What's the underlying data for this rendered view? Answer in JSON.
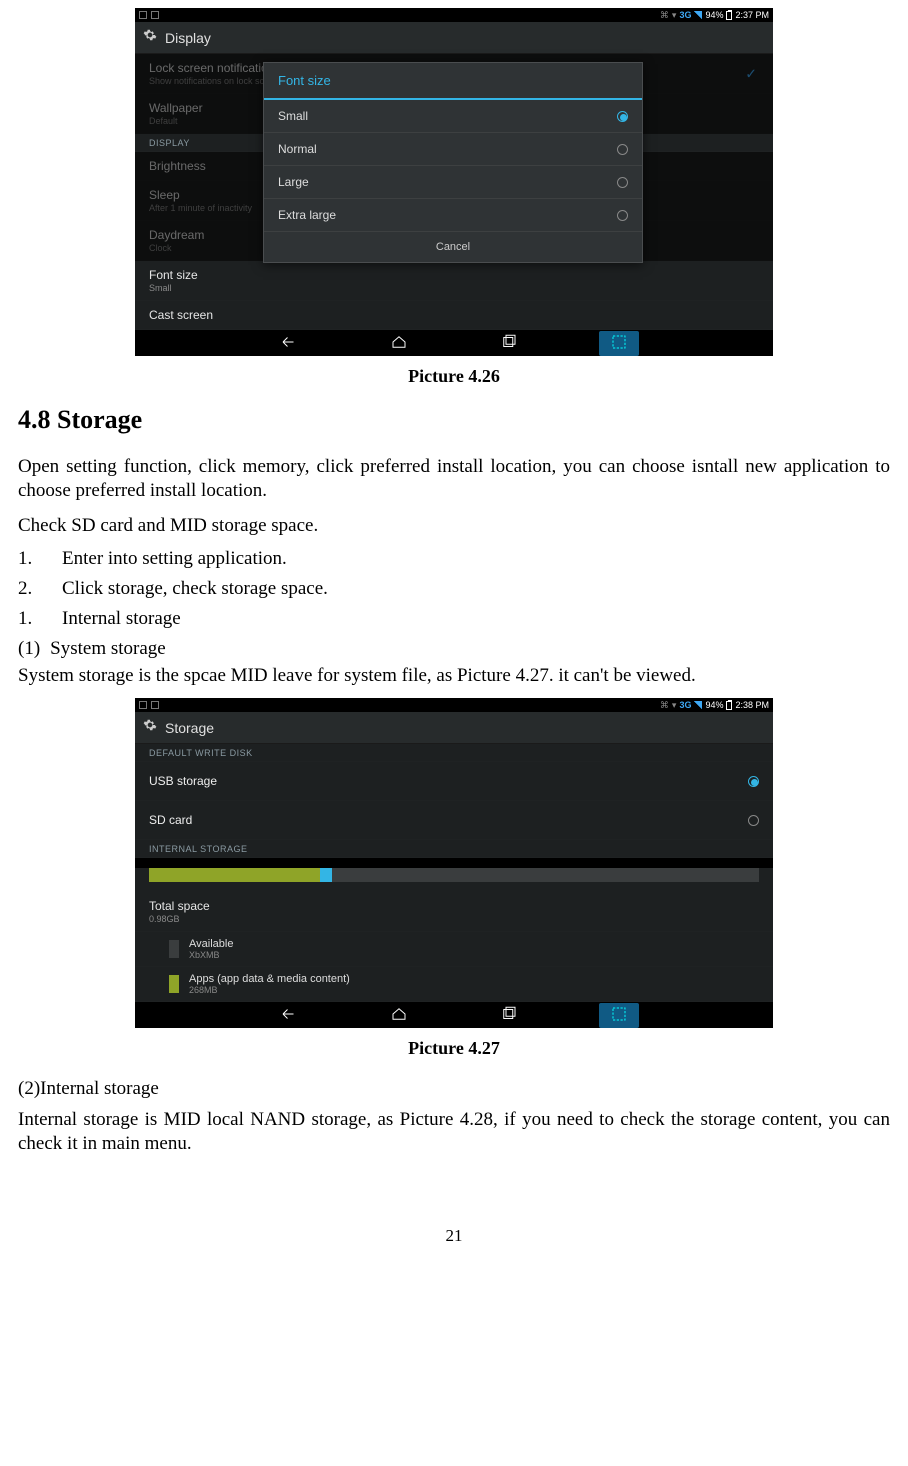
{
  "screenshot1": {
    "status": {
      "threeg": "3G",
      "battery": "94%",
      "time": "2:37 PM"
    },
    "title": "Display",
    "rows": {
      "locknotif": {
        "title": "Lock screen notifications",
        "sub": "Show notifications on lock screen"
      },
      "wallpaper": {
        "title": "Wallpaper",
        "sub": "Default"
      },
      "display_header": "DISPLAY",
      "brightness": {
        "title": "Brightness"
      },
      "sleep": {
        "title": "Sleep",
        "sub": "After 1 minute of inactivity"
      },
      "daydream": {
        "title": "Daydream",
        "sub": "Clock"
      },
      "fontsize": {
        "title": "Font size",
        "sub": "Small"
      },
      "cast": {
        "title": "Cast screen"
      }
    },
    "dialog": {
      "title": "Font size",
      "options": [
        "Small",
        "Normal",
        "Large",
        "Extra large"
      ],
      "cancel": "Cancel"
    }
  },
  "caption1": "Picture 4.26",
  "heading": "4.8 Storage",
  "para1": "Open setting function, click memory, click preferred install location, you can choose isntall new application to choose preferred install location.",
  "para2": "Check SD card and MID storage space.",
  "list": {
    "i1": {
      "n": "1.",
      "t": "Enter into setting application."
    },
    "i2": {
      "n": "2.",
      "t": "Click storage, check storage space."
    },
    "i3": {
      "n": "1.",
      "t": "Internal storage"
    },
    "i4": {
      "n": "(1)",
      "t": "System storage"
    }
  },
  "para3": "System storage is the spcae MID leave for system file, as Picture 4.27. it can't be viewed.",
  "screenshot2": {
    "status": {
      "threeg": "3G",
      "battery": "94%",
      "time": "2:38 PM"
    },
    "title": "Storage",
    "default_header": "DEFAULT WRITE DISK",
    "usb": "USB storage",
    "sd": "SD card",
    "internal_header": "INTERNAL STORAGE",
    "total": {
      "title": "Total space",
      "sub": "0.98GB"
    },
    "available": {
      "title": "Available",
      "sub": "XbXMB"
    },
    "apps": {
      "title": "Apps (app data & media content)",
      "sub": "268MB"
    }
  },
  "caption2": "Picture 4.27",
  "para4": "(2)Internal storage",
  "para5": "Internal storage is MID local NAND storage, as Picture 4.28, if you need to check the storage content, you can check it in main menu.",
  "pagenum": "21"
}
